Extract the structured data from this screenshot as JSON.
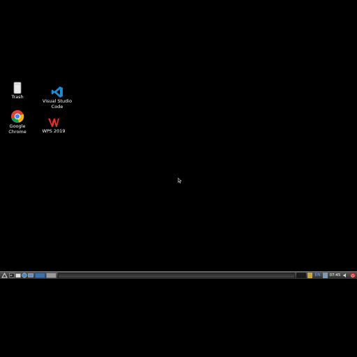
{
  "desktop": {
    "icons": [
      {
        "label": "Trash",
        "icon": "trash-icon"
      },
      {
        "label": "Visual Studio Code",
        "icon": "vscode-icon"
      },
      {
        "label": "Google Chrome",
        "icon": "chrome-icon"
      },
      {
        "label": "WPS 2019",
        "icon": "wps-icon"
      }
    ]
  },
  "taskbar": {
    "language": "EN",
    "clock": "07:45",
    "colors": {
      "workspace_active": "#3f6fa8",
      "power": "#d22",
      "vscode": "#1f8ad2",
      "wps": "#e0312b"
    }
  }
}
